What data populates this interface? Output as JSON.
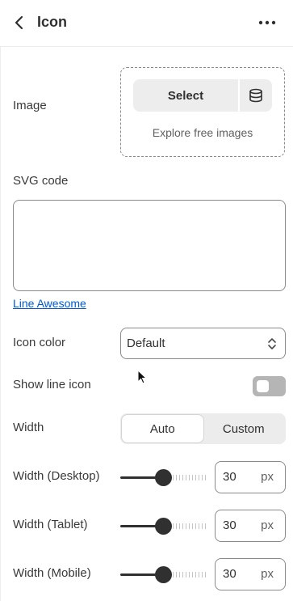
{
  "header": {
    "title": "Icon",
    "back_icon": "chevron-left-icon",
    "more_icon": "horizontal-dots-icon"
  },
  "image": {
    "label": "Image",
    "select_label": "Select",
    "library_icon": "database-icon",
    "explore_label": "Explore free images"
  },
  "svg_code": {
    "label": "SVG code",
    "value": "",
    "link_label": "Line Awesome"
  },
  "icon_color": {
    "label": "Icon color",
    "value": "Default"
  },
  "show_line_icon": {
    "label": "Show line icon",
    "enabled": false
  },
  "width": {
    "label": "Width",
    "options": [
      "Auto",
      "Custom"
    ],
    "selected": "Auto"
  },
  "width_desktop": {
    "label": "Width (Desktop)",
    "value": "30",
    "unit": "px",
    "slider_fraction": 0.49
  },
  "width_tablet": {
    "label": "Width (Tablet)",
    "value": "30",
    "unit": "px",
    "slider_fraction": 0.49
  },
  "width_mobile": {
    "label": "Width (Mobile)",
    "value": "30",
    "unit": "px",
    "slider_fraction": 0.49
  }
}
